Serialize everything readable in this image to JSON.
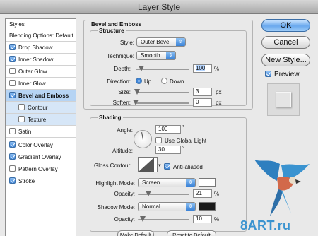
{
  "window": {
    "title": "Layer Style"
  },
  "styles_panel": {
    "items": [
      {
        "label": "Styles",
        "checked": null
      },
      {
        "label": "Blending Options: Default",
        "checked": null
      },
      {
        "label": "Drop Shadow",
        "checked": true
      },
      {
        "label": "Inner Shadow",
        "checked": true
      },
      {
        "label": "Outer Glow",
        "checked": false
      },
      {
        "label": "Inner Glow",
        "checked": false
      },
      {
        "label": "Bevel and Emboss",
        "checked": true
      },
      {
        "label": "Contour",
        "checked": false
      },
      {
        "label": "Texture",
        "checked": false
      },
      {
        "label": "Satin",
        "checked": false
      },
      {
        "label": "Color Overlay",
        "checked": true
      },
      {
        "label": "Gradient Overlay",
        "checked": true
      },
      {
        "label": "Pattern Overlay",
        "checked": false
      },
      {
        "label": "Stroke",
        "checked": true
      }
    ]
  },
  "bevel": {
    "title": "Bevel and Emboss",
    "structure_title": "Structure",
    "style_label": "Style:",
    "style_value": "Outer Bevel",
    "technique_label": "Technique:",
    "technique_value": "Smooth",
    "depth_label": "Depth:",
    "depth_value": "100",
    "depth_unit": "%",
    "depth_fraction": 0.1,
    "direction_label": "Direction:",
    "dir_up": "Up",
    "dir_down": "Down",
    "size_label": "Size:",
    "size_value": "3",
    "size_unit": "px",
    "size_fraction": 0.02,
    "soften_label": "Soften:",
    "soften_value": "0",
    "soften_unit": "px",
    "soften_fraction": 0.0
  },
  "shading": {
    "title": "Shading",
    "angle_label": "Angle:",
    "angle_value": "100",
    "angle_unit": "°",
    "global_light_label": "Use Global Light",
    "altitude_label": "Altitude:",
    "altitude_value": "30",
    "altitude_unit": "°",
    "gloss_label": "Gloss Contour:",
    "antialiased_label": "Anti-aliased",
    "highlight_label": "Highlight Mode:",
    "highlight_value": "Screen",
    "highlight_color": "#ffffff",
    "highlight_opacity_label": "Opacity:",
    "highlight_opacity": "21",
    "opacity_unit": "%",
    "highlight_opacity_fraction": 0.21,
    "shadow_label": "Shadow Mode:",
    "shadow_value": "Normal",
    "shadow_color": "#1a1a1a",
    "shadow_opacity_label": "Opacity:",
    "shadow_opacity": "10",
    "shadow_opacity_fraction": 0.1
  },
  "buttons": {
    "ok": "OK",
    "cancel": "Cancel",
    "new_style": "New Style...",
    "preview": "Preview",
    "make_default": "Make Default",
    "reset_default": "Reset to Default"
  },
  "watermark": {
    "text": "8ART.ru"
  },
  "colors": {
    "accent": "#3f86d8",
    "selection": "#b6d4f4"
  }
}
